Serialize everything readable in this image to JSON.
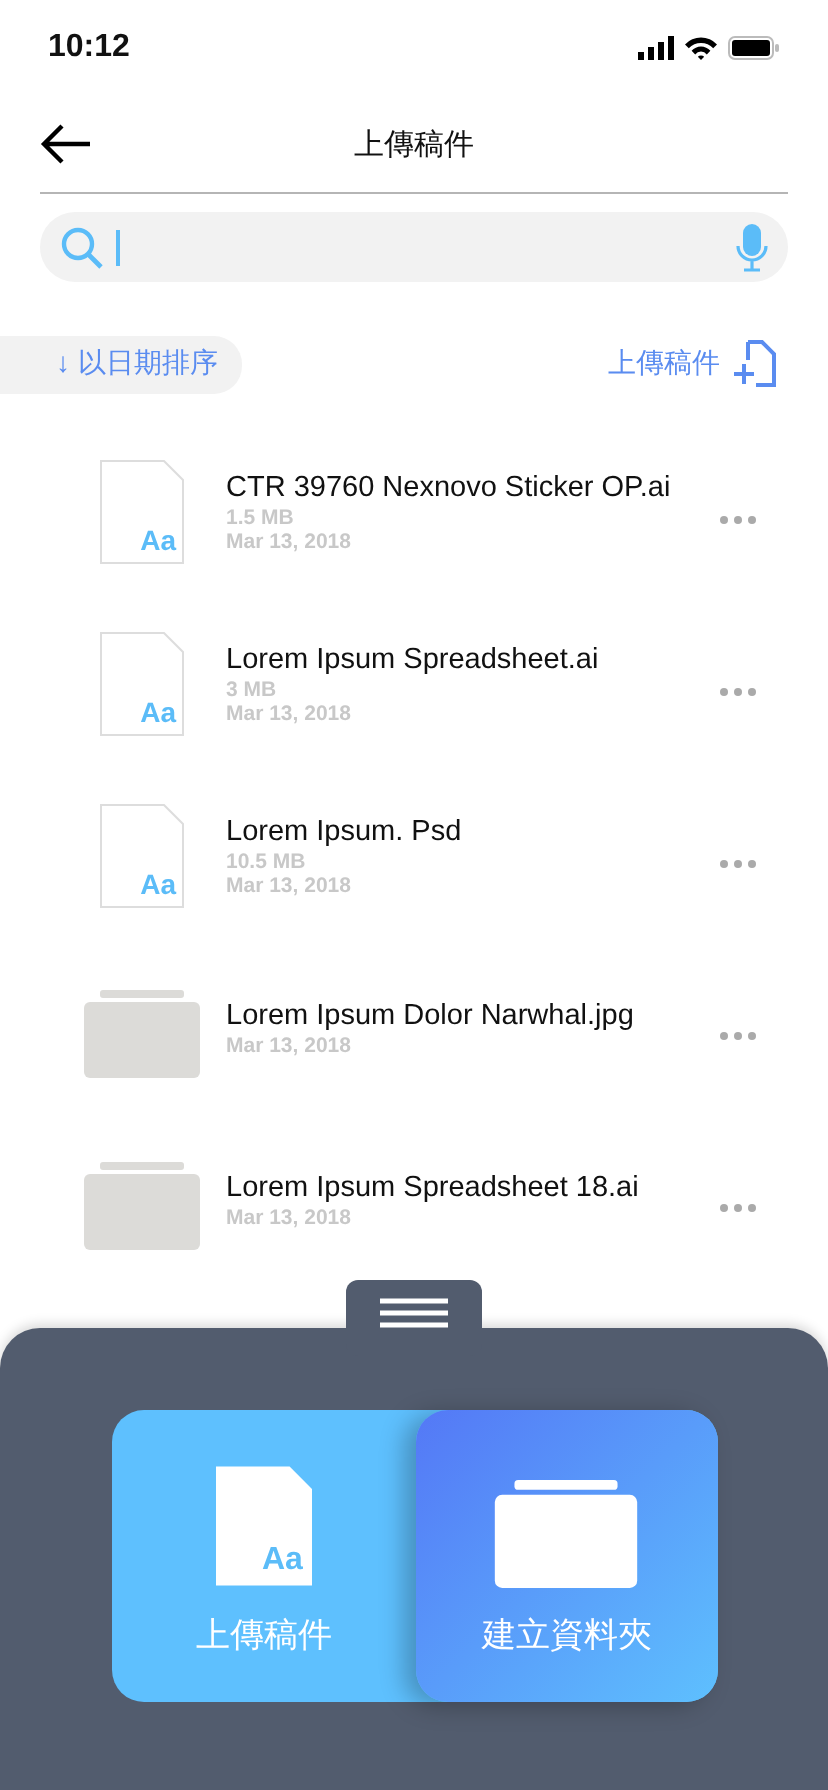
{
  "status_bar": {
    "time": "10:12"
  },
  "header": {
    "title": "上傳稿件"
  },
  "toolbar": {
    "sort": "↓ 以日期排序",
    "upload": "上傳稿件"
  },
  "files": [
    {
      "kind": "file",
      "icon_text": "Aa",
      "name": "CTR 39760 Nexnovo Sticker OP.ai",
      "size": "1.5 MB",
      "date": "Mar 13, 2018"
    },
    {
      "kind": "file",
      "icon_text": "Aa",
      "name": "Lorem Ipsum Spreadsheet.ai",
      "size": "3 MB",
      "date": "Mar 13, 2018"
    },
    {
      "kind": "file",
      "icon_text": "Aa",
      "name": "Lorem Ipsum. Psd",
      "size": "10.5 MB",
      "date": "Mar 13, 2018"
    },
    {
      "kind": "folder",
      "name": "Lorem Ipsum Dolor Narwhal.jpg",
      "date": "Mar 13, 2018"
    },
    {
      "kind": "folder",
      "name": "Lorem Ipsum Spreadsheet 18.ai",
      "date": "Mar 13, 2018"
    }
  ],
  "sheet": {
    "options": [
      {
        "kind": "file",
        "icon_text": "Aa",
        "label": "上傳稿件",
        "selected": false
      },
      {
        "kind": "folder",
        "label": "建立資料夾",
        "selected": true
      }
    ]
  }
}
